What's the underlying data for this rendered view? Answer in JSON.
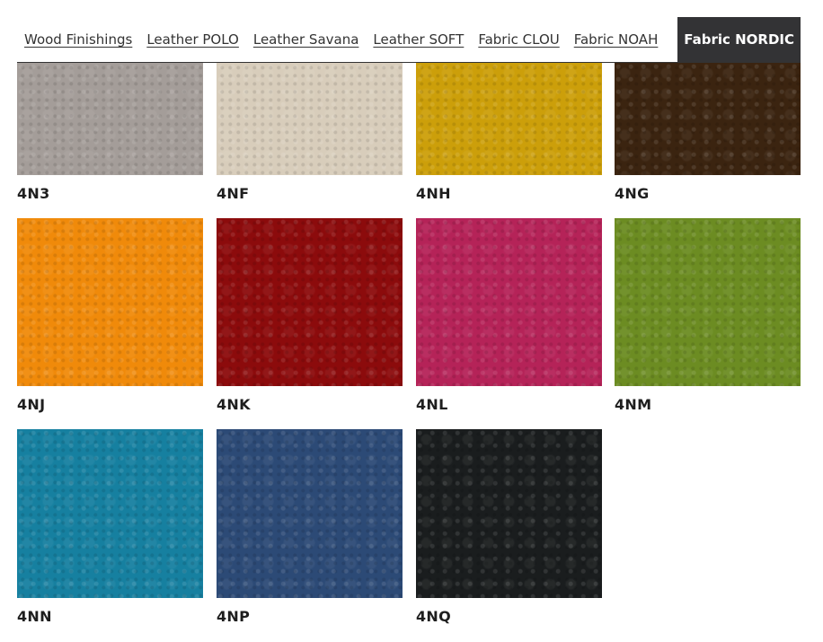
{
  "tabs": [
    {
      "label": "Wood Finishings",
      "active": false
    },
    {
      "label": "Leather POLO",
      "active": false
    },
    {
      "label": "Leather Savana",
      "active": false
    },
    {
      "label": "Leather SOFT",
      "active": false
    },
    {
      "label": "Fabric CLOU",
      "active": false
    },
    {
      "label": "Fabric NOAH",
      "active": false
    },
    {
      "label": "Fabric NORDIC",
      "active": true
    }
  ],
  "swatches": [
    {
      "code": "4N3",
      "color": "#a49d99"
    },
    {
      "code": "4NF",
      "color": "#d8cdbb"
    },
    {
      "code": "4NH",
      "color": "#cc9f0a"
    },
    {
      "code": "4NG",
      "color": "#3b2410"
    },
    {
      "code": "4NJ",
      "color": "#f08a0a"
    },
    {
      "code": "4NK",
      "color": "#8c0b0c"
    },
    {
      "code": "4NL",
      "color": "#b52358"
    },
    {
      "code": "4NM",
      "color": "#6c8c22"
    },
    {
      "code": "4NN",
      "color": "#1680a0"
    },
    {
      "code": "4NP",
      "color": "#2c4a76"
    },
    {
      "code": "4NQ",
      "color": "#1a1d1e"
    }
  ]
}
